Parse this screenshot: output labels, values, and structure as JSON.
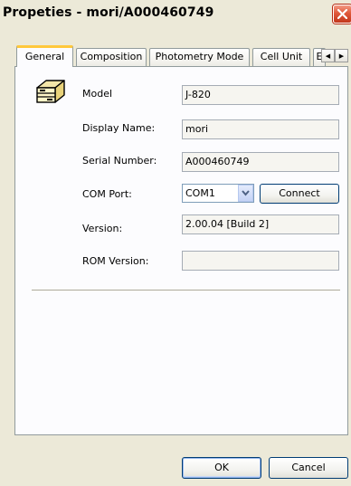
{
  "window": {
    "title": "Propeties - mori/A000460749"
  },
  "tabs": [
    {
      "label": "General",
      "active": true
    },
    {
      "label": "Composition",
      "active": false
    },
    {
      "label": "Photometry Mode",
      "active": false
    },
    {
      "label": "Cell Unit",
      "active": false
    },
    {
      "label": "E",
      "active": false
    }
  ],
  "general": {
    "device_icon": "device-icon",
    "model": {
      "label": "Model",
      "value": "J-820"
    },
    "display_name": {
      "label": "Display Name:",
      "value": "mori"
    },
    "serial_number": {
      "label": "Serial Number:",
      "value": "A000460749"
    },
    "com_port": {
      "label": "COM Port:",
      "value": "COM1",
      "connect_label": "Connect"
    },
    "version": {
      "label": "Version:",
      "value": "2.00.04 [Build 2]"
    },
    "rom_version": {
      "label": "ROM Version:",
      "value": ""
    }
  },
  "buttons": {
    "ok": "OK",
    "cancel": "Cancel"
  },
  "colors": {
    "dialog_bg": "#ece9d8",
    "panel_bg": "#fcfcfe",
    "active_tab_accent": "#ffc83c",
    "close_button": "#e0583a",
    "default_button_border": "#003c74"
  }
}
